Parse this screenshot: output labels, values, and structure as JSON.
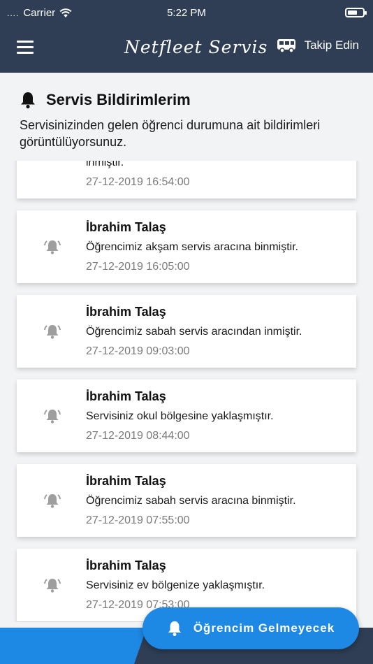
{
  "status_bar": {
    "dots": "....",
    "carrier": "Carrier",
    "time": "5:22 PM"
  },
  "nav": {
    "brand": "Netfleet Servis",
    "follow_label": "Takip Edin"
  },
  "header": {
    "title": "Servis Bildirimlerim",
    "description": "Servisinizinden gelen öğrenci durumuna ait bildirimleri görüntülüyorsunuz."
  },
  "notifications": [
    {
      "name": "",
      "message": "inmiştir.",
      "date": "27-12-2019 16:54:00"
    },
    {
      "name": "İbrahim Talaş",
      "message": "Öğrencimiz akşam servis aracına binmiştir.",
      "date": "27-12-2019 16:05:00"
    },
    {
      "name": "İbrahim Talaş",
      "message": "Öğrencimiz sabah servis aracından inmiştir.",
      "date": "27-12-2019 09:03:00"
    },
    {
      "name": "İbrahim Talaş",
      "message": "Servisiniz okul bölgesine yaklaşmıştır.",
      "date": "27-12-2019 08:44:00"
    },
    {
      "name": "İbrahim Talaş",
      "message": "Öğrencimiz sabah servis aracına binmiştir.",
      "date": "27-12-2019 07:55:00"
    },
    {
      "name": "İbrahim Talaş",
      "message": "Servisiniz ev bölgenize yaklaşmıştır.",
      "date": "27-12-2019 07:53:00"
    }
  ],
  "fab": {
    "label": "Öğrencim Gelmeyecek"
  },
  "colors": {
    "navbar": "#2f3e55",
    "accent": "#1e88e5",
    "background": "#f2f3f5",
    "date_text": "#7a7a7a",
    "bell_gray": "#9e9e9e"
  },
  "icons": {
    "menu": "hamburger-icon",
    "follow": "bus-icon",
    "header": "bell-icon",
    "notification": "ringing-bell-icon",
    "fab": "bell-icon",
    "wifi": "wifi-icon",
    "battery": "battery-icon"
  }
}
